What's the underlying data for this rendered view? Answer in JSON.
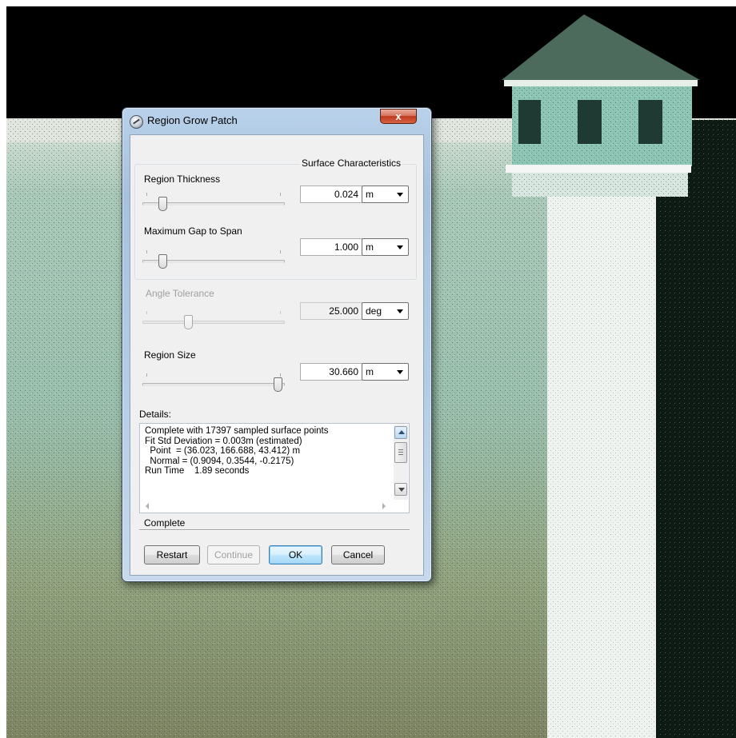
{
  "window": {
    "title": "Region Grow Patch",
    "close_glyph": "x"
  },
  "group": {
    "label": "Surface Characteristics"
  },
  "fields": [
    {
      "label": "Region Thickness",
      "value": "0.024",
      "unit": "m",
      "slider_fraction": 0.14,
      "enabled": true
    },
    {
      "label": "Maximum Gap to Span",
      "value": "1.000",
      "unit": "m",
      "slider_fraction": 0.14,
      "enabled": true
    },
    {
      "label": "Angle Tolerance",
      "value": "25.000",
      "unit": "deg",
      "slider_fraction": 0.3,
      "enabled": false
    },
    {
      "label": "Region Size",
      "value": "30.660",
      "unit": "m",
      "slider_fraction": 1.0,
      "enabled": true
    }
  ],
  "details": {
    "label": "Details:",
    "lines": [
      "Complete with 17397 sampled surface points",
      "Fit Std Deviation = 0.003m (estimated)",
      "  Point  = (36.023, 166.688, 43.412) m",
      "  Normal = (0.9094, 0.3544, -0.2175)",
      "Run Time    1.89 seconds"
    ]
  },
  "status": {
    "text": "Complete"
  },
  "buttons": {
    "restart": "Restart",
    "continue": "Continue",
    "ok": "OK",
    "cancel": "Cancel"
  },
  "colors": {
    "title_gradient_top": "#b9d1ea",
    "close_button": "#c0391f",
    "ok_default_border": "#3c7fb1",
    "scene_wall": "#9cc1b1",
    "scene_sky": "#000000"
  },
  "icons": [
    "app-icon",
    "close-icon",
    "chevron-down-icon",
    "scroll-up-icon",
    "scroll-down-icon",
    "scroll-left-icon",
    "scroll-right-icon"
  ]
}
